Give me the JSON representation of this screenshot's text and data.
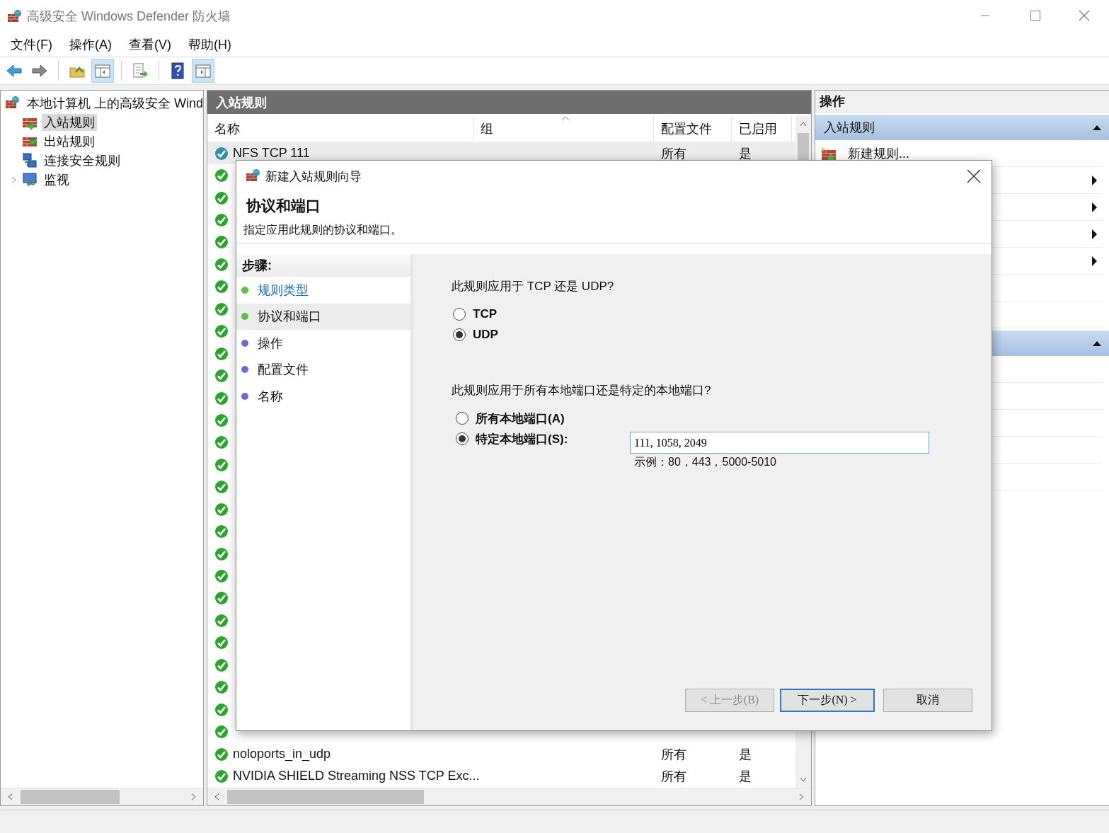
{
  "window": {
    "title": "高级安全 Windows Defender 防火墙"
  },
  "menu": [
    {
      "label": "文件(F)"
    },
    {
      "label": "操作(A)"
    },
    {
      "label": "查看(V)"
    },
    {
      "label": "帮助(H)"
    }
  ],
  "toolbar": [
    {
      "kind": "back",
      "pressed": false
    },
    {
      "kind": "forward",
      "pressed": false
    },
    {
      "kind": "separator"
    },
    {
      "kind": "up",
      "pressed": false
    },
    {
      "kind": "tree",
      "pressed": true
    },
    {
      "kind": "separator"
    },
    {
      "kind": "export",
      "pressed": false
    },
    {
      "kind": "separator"
    },
    {
      "kind": "help",
      "pressed": false
    },
    {
      "kind": "actions",
      "pressed": true
    }
  ],
  "tree": {
    "label": "本地计算机 上的高级安全 Wind",
    "children": [
      {
        "label": "入站规则",
        "kind": "inbound",
        "selected": true,
        "collapsed": false
      },
      {
        "label": "出站规则",
        "kind": "outbound",
        "selected": false,
        "collapsed": false
      },
      {
        "label": "连接安全规则",
        "kind": "security",
        "selected": false,
        "collapsed": false
      },
      {
        "label": "监视",
        "kind": "monitor",
        "selected": false,
        "collapsed": true
      }
    ]
  },
  "table": {
    "title": "入站规则",
    "columns": [
      "名称",
      "组",
      "配置文件",
      "已启用"
    ],
    "rows": [
      {
        "name": "NFS TCP 111",
        "profile": "所有",
        "enabled": "是",
        "selected": true
      },
      {
        "selected": false
      },
      {
        "selected": false
      },
      {
        "selected": false
      },
      {
        "selected": false
      },
      {
        "selected": false
      },
      {
        "selected": false
      },
      {
        "selected": false
      },
      {
        "selected": false
      },
      {
        "selected": false
      },
      {
        "selected": false
      },
      {
        "selected": false
      },
      {
        "selected": false
      },
      {
        "selected": false
      },
      {
        "selected": false
      },
      {
        "selected": false
      },
      {
        "selected": false
      },
      {
        "selected": false
      },
      {
        "selected": false
      },
      {
        "selected": false
      },
      {
        "selected": false
      },
      {
        "selected": false
      },
      {
        "selected": false
      },
      {
        "selected": false
      },
      {
        "selected": false
      },
      {
        "selected": false
      },
      {
        "selected": false
      },
      {
        "name": "noloports_in_udp",
        "profile": "所有",
        "enabled": "是",
        "selected": false
      },
      {
        "name": "NVIDIA SHIELD Streaming NSS TCP Exc...",
        "profile": "所有",
        "enabled": "是",
        "selected": false
      }
    ]
  },
  "actions": {
    "title": "操作",
    "items": [
      {
        "kind": "section",
        "label": "入站规则",
        "expanded": true
      },
      {
        "kind": "action",
        "label": "新建规则..."
      },
      {
        "kind": "submenu"
      },
      {
        "kind": "submenu"
      },
      {
        "kind": "submenu"
      },
      {
        "kind": "submenu"
      },
      {
        "kind": "action"
      },
      {
        "kind": "action"
      },
      {
        "kind": "section",
        "expanded": true
      },
      {
        "kind": "action"
      },
      {
        "kind": "action"
      },
      {
        "kind": "action"
      },
      {
        "kind": "action"
      },
      {
        "kind": "action"
      }
    ]
  },
  "dialog": {
    "title": "新建入站规则向导",
    "heading": "协议和端口",
    "subtitle": "指定应用此规则的协议和端口。",
    "steps_title": "步骤:",
    "steps": [
      {
        "label": "规则类型",
        "done": true,
        "selected": false
      },
      {
        "label": "协议和端口",
        "done": true,
        "selected": true
      },
      {
        "label": "操作",
        "done": false,
        "selected": false
      },
      {
        "label": "配置文件",
        "done": false,
        "selected": false
      },
      {
        "label": "名称",
        "done": false,
        "selected": false
      }
    ],
    "protocol_question": "此规则应用于 TCP 还是 UDP?",
    "protocols": [
      {
        "label": "TCP",
        "selected": false
      },
      {
        "label": "UDP",
        "selected": true
      }
    ],
    "port_question": "此规则应用于所有本地端口还是特定的本地端口?",
    "ports": [
      {
        "label": "所有本地端口(A)",
        "selected": false
      },
      {
        "label": "特定本地端口(S):",
        "selected": true
      }
    ],
    "port_field": {
      "value": "111, 1058, 2049"
    },
    "example": "示例：80，443，5000-5010",
    "buttons": [
      {
        "label": "< 上一步(B)",
        "disabled": true,
        "focused": false
      },
      {
        "label": "下一步(N) >",
        "disabled": false,
        "focused": true
      },
      {
        "label": "取消",
        "disabled": false,
        "focused": false
      }
    ]
  }
}
